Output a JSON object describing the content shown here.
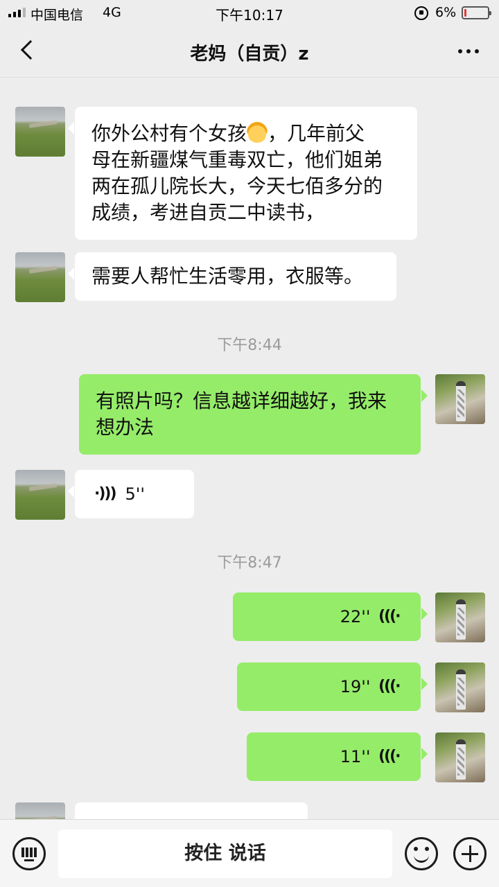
{
  "status_bar": {
    "carrier": "中国电信",
    "network": "4G",
    "time": "下午10:17",
    "battery_percent": "6%",
    "battery_level": 0.06,
    "battery_color": "#e53935",
    "icons": [
      "signal-icon",
      "rotation-lock-icon",
      "battery-icon"
    ]
  },
  "header": {
    "title": "老妈（自贡）z",
    "back_icon": "chevron-left-icon",
    "more_icon": "more-dots-icon"
  },
  "messages": [
    {
      "type": "text",
      "direction": "in",
      "text_before_emoji": "你外公村有个女孩",
      "emoji": "girl-emoji",
      "text_after_emoji": "，几年前父母在新疆煤气重毒双亡，他们姐弟两在孤儿院长大，今天七佰多分的成绩，考进自贡二中读书，",
      "lines": [
        "你外公村有个女孩",
        "，几年前父",
        "母在新疆煤气重毒双亡，他们姐弟",
        "两在孤儿院长大，今天七佰多分的",
        "成绩，考进自贡二中读书，"
      ]
    },
    {
      "type": "text",
      "direction": "in",
      "text": "需要人帮忙生活零用，衣服等。"
    },
    {
      "type": "timestamp",
      "text": "下午8:44"
    },
    {
      "type": "text",
      "direction": "out",
      "lines": [
        "有照片吗？信息越详细越好，我来",
        "想办法"
      ]
    },
    {
      "type": "voice",
      "direction": "in",
      "duration": "5''"
    },
    {
      "type": "timestamp",
      "text": "下午8:47"
    },
    {
      "type": "voice",
      "direction": "out",
      "duration": "22''"
    },
    {
      "type": "voice",
      "direction": "out",
      "duration": "19''"
    },
    {
      "type": "voice",
      "direction": "out",
      "duration": "11''"
    }
  ],
  "input_bar": {
    "hold_to_talk": "按住 说话",
    "keyboard_icon": "keyboard-icon",
    "emoji_icon": "emoji-icon",
    "plus_icon": "plus-icon"
  },
  "colors": {
    "background": "#ededed",
    "incoming_bubble": "#ffffff",
    "outgoing_bubble": "#95ec69",
    "timestamp": "#9b9b9b"
  }
}
